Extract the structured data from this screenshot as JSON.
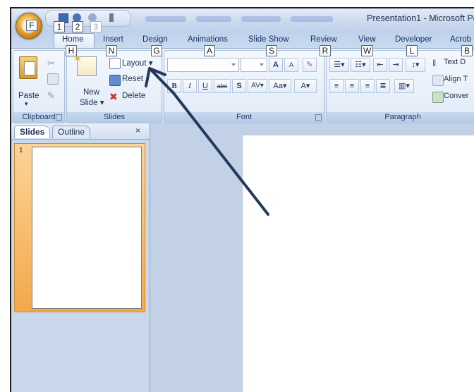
{
  "window": {
    "title": "Presentation1 - Microsoft Po"
  },
  "keytips": {
    "office": "F",
    "qat_1": "1",
    "qat_2": "2",
    "qat_3": "3",
    "home": "H",
    "insert": "N",
    "design": "G",
    "animations": "A",
    "slideshow": "S",
    "review": "R",
    "view": "W",
    "developer": "L",
    "acrobat": "B"
  },
  "tabs": {
    "home": "Home",
    "insert": "Insert",
    "design": "Design",
    "animations": "Animations",
    "slideshow": "Slide Show",
    "review": "Review",
    "view": "View",
    "developer": "Developer",
    "acrobat": "Acrob"
  },
  "ribbon": {
    "clipboard": {
      "label": "Clipboard",
      "paste": "Paste"
    },
    "slides": {
      "label": "Slides",
      "new_slide_1": "New",
      "new_slide_2": "Slide",
      "layout": "Layout",
      "reset": "Reset",
      "delete": "Delete"
    },
    "font": {
      "label": "Font",
      "bold": "B",
      "italic": "I",
      "underline": "U",
      "strike": "abc",
      "shadow": "S",
      "spacing": "AV",
      "case": "Aa",
      "color": "A",
      "grow": "A",
      "shrink": "A"
    },
    "paragraph": {
      "label": "Paragraph",
      "text_direction": "Text D",
      "align_text": "Align T",
      "convert": "Conver"
    }
  },
  "pane": {
    "tab_slides": "Slides",
    "tab_outline": "Outline",
    "close": "×",
    "thumb_number": "1"
  },
  "colors": {
    "ribbon_bg": "#dde8f6",
    "arrow": "#23395d",
    "thumb_selected": "#f3a84c"
  }
}
